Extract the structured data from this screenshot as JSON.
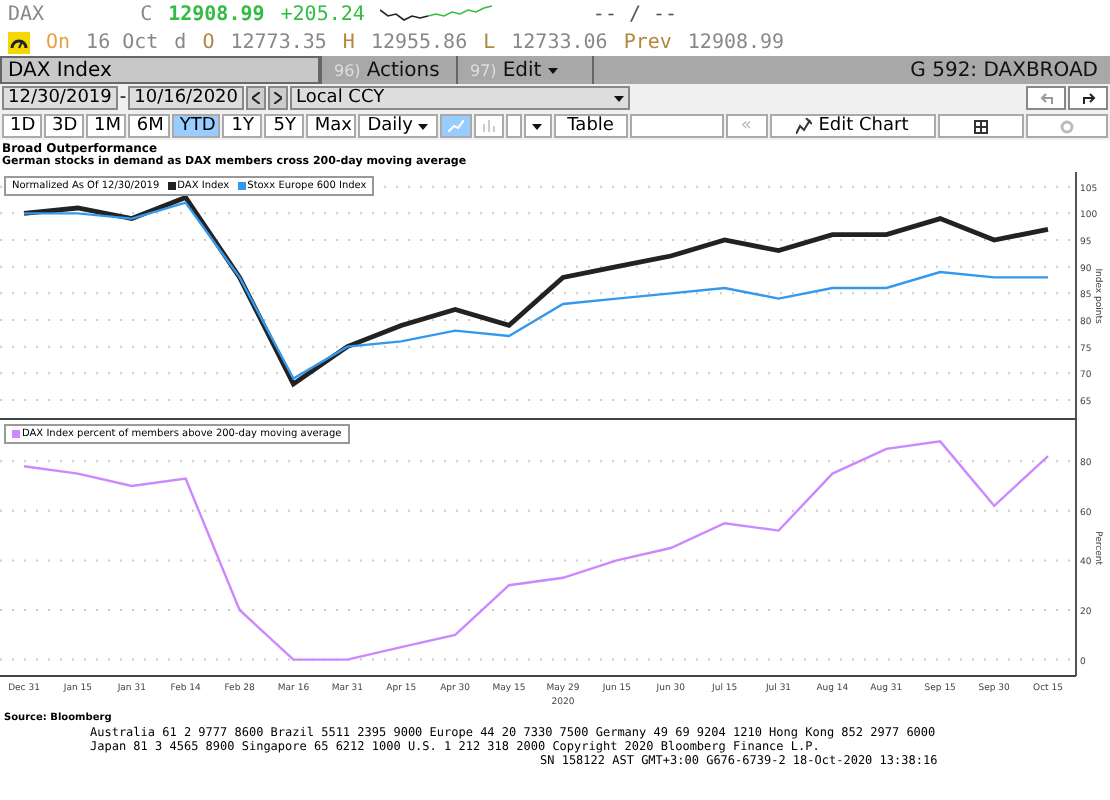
{
  "quote": {
    "ticker": "DAX",
    "close_label": "C",
    "close": "12908.99",
    "change": "+205.24",
    "bid_ask": "-- / --",
    "date_label": "On",
    "date": "16 Oct",
    "date_flag": "d",
    "open_label": "O",
    "open": "12773.35",
    "high_label": "H",
    "high": "12955.86",
    "low_label": "L",
    "low": "12733.06",
    "prev_label": "Prev",
    "prev": "12908.99"
  },
  "toolbar": {
    "security": "DAX Index",
    "menus": [
      {
        "number": "96)",
        "label": "Actions"
      },
      {
        "number": "97)",
        "label": "Edit"
      }
    ],
    "function": "G 592: DAXBROAD",
    "start_date": "12/30/2019",
    "date_separator": "-",
    "end_date": "10/16/2020",
    "currency": "Local CCY"
  },
  "periods": [
    {
      "label": "1D",
      "selected": false
    },
    {
      "label": "3D",
      "selected": false
    },
    {
      "label": "1M",
      "selected": false
    },
    {
      "label": "6M",
      "selected": false
    },
    {
      "label": "YTD",
      "selected": true
    },
    {
      "label": "1Y",
      "selected": false
    },
    {
      "label": "5Y",
      "selected": false
    },
    {
      "label": "Max",
      "selected": false
    }
  ],
  "frequency": "Daily",
  "table_button": "Table",
  "back_button": "«",
  "edit_chart_button": "Edit Chart",
  "chart": {
    "title": "Broad Outperformance",
    "subtitle": "German stocks in demand as DAX members cross 200-day moving average",
    "panels": [
      {
        "legend_note": "Normalized As Of 12/30/2019",
        "chart_data": {
          "type": "line",
          "grid": true,
          "ylabel": "Index points",
          "ylim": [
            62,
            107
          ],
          "yticks": [
            65,
            70,
            75,
            80,
            85,
            90,
            95,
            100,
            105
          ],
          "series": [
            {
              "name": "DAX Index",
              "color": "#222222",
              "values": [
                100,
                101,
                99,
                103,
                88,
                68,
                75,
                79,
                82,
                79,
                88,
                90,
                92,
                95,
                93,
                96,
                96,
                99,
                95,
                97
              ]
            },
            {
              "name": "Stoxx Europe 600 Index",
              "color": "#3399ee",
              "values": [
                100,
                100,
                99,
                102,
                88,
                69,
                75,
                76,
                78,
                77,
                83,
                84,
                85,
                86,
                84,
                86,
                86,
                89,
                88,
                88
              ]
            }
          ]
        }
      },
      {
        "chart_data": {
          "type": "line",
          "grid": true,
          "xlabel": "2020",
          "ylabel": "Percent",
          "categories": [
            "Dec 31",
            "Jan 15",
            "Jan 31",
            "Feb 14",
            "Feb 28",
            "Mar 16",
            "Mar 31",
            "Apr 15",
            "Apr 30",
            "May 15",
            "May 29",
            "Jun 15",
            "Jun 30",
            "Jul 15",
            "Jul 31",
            "Aug 14",
            "Aug 31",
            "Sep 15",
            "Sep 30",
            "Oct 15"
          ],
          "ylim": [
            -5,
            95
          ],
          "yticks": [
            0,
            20,
            40,
            60,
            80
          ],
          "series": [
            {
              "name": "DAX Index percent of members above 200-day moving average",
              "color": "#cc88ff",
              "values": [
                78,
                75,
                70,
                73,
                20,
                0,
                0,
                5,
                10,
                30,
                33,
                40,
                45,
                55,
                52,
                75,
                85,
                88,
                62,
                82
              ]
            }
          ]
        }
      }
    ],
    "source": "Source: Bloomberg"
  },
  "footer": [
    "Australia 61 2 9777 8600 Brazil 5511 2395 9000 Europe 44 20 7330 7500 Germany 49 69 9204 1210 Hong Kong 852 2977 6000",
    "Japan 81 3 4565 8900 Singapore 65 6212 1000 U.S. 1 212 318 2000 Copyright 2020 Bloomberg Finance L.P.",
    "SN 158122 AST GMT+3:00 G676-6739-2 18-Oct-2020 13:38:16"
  ]
}
